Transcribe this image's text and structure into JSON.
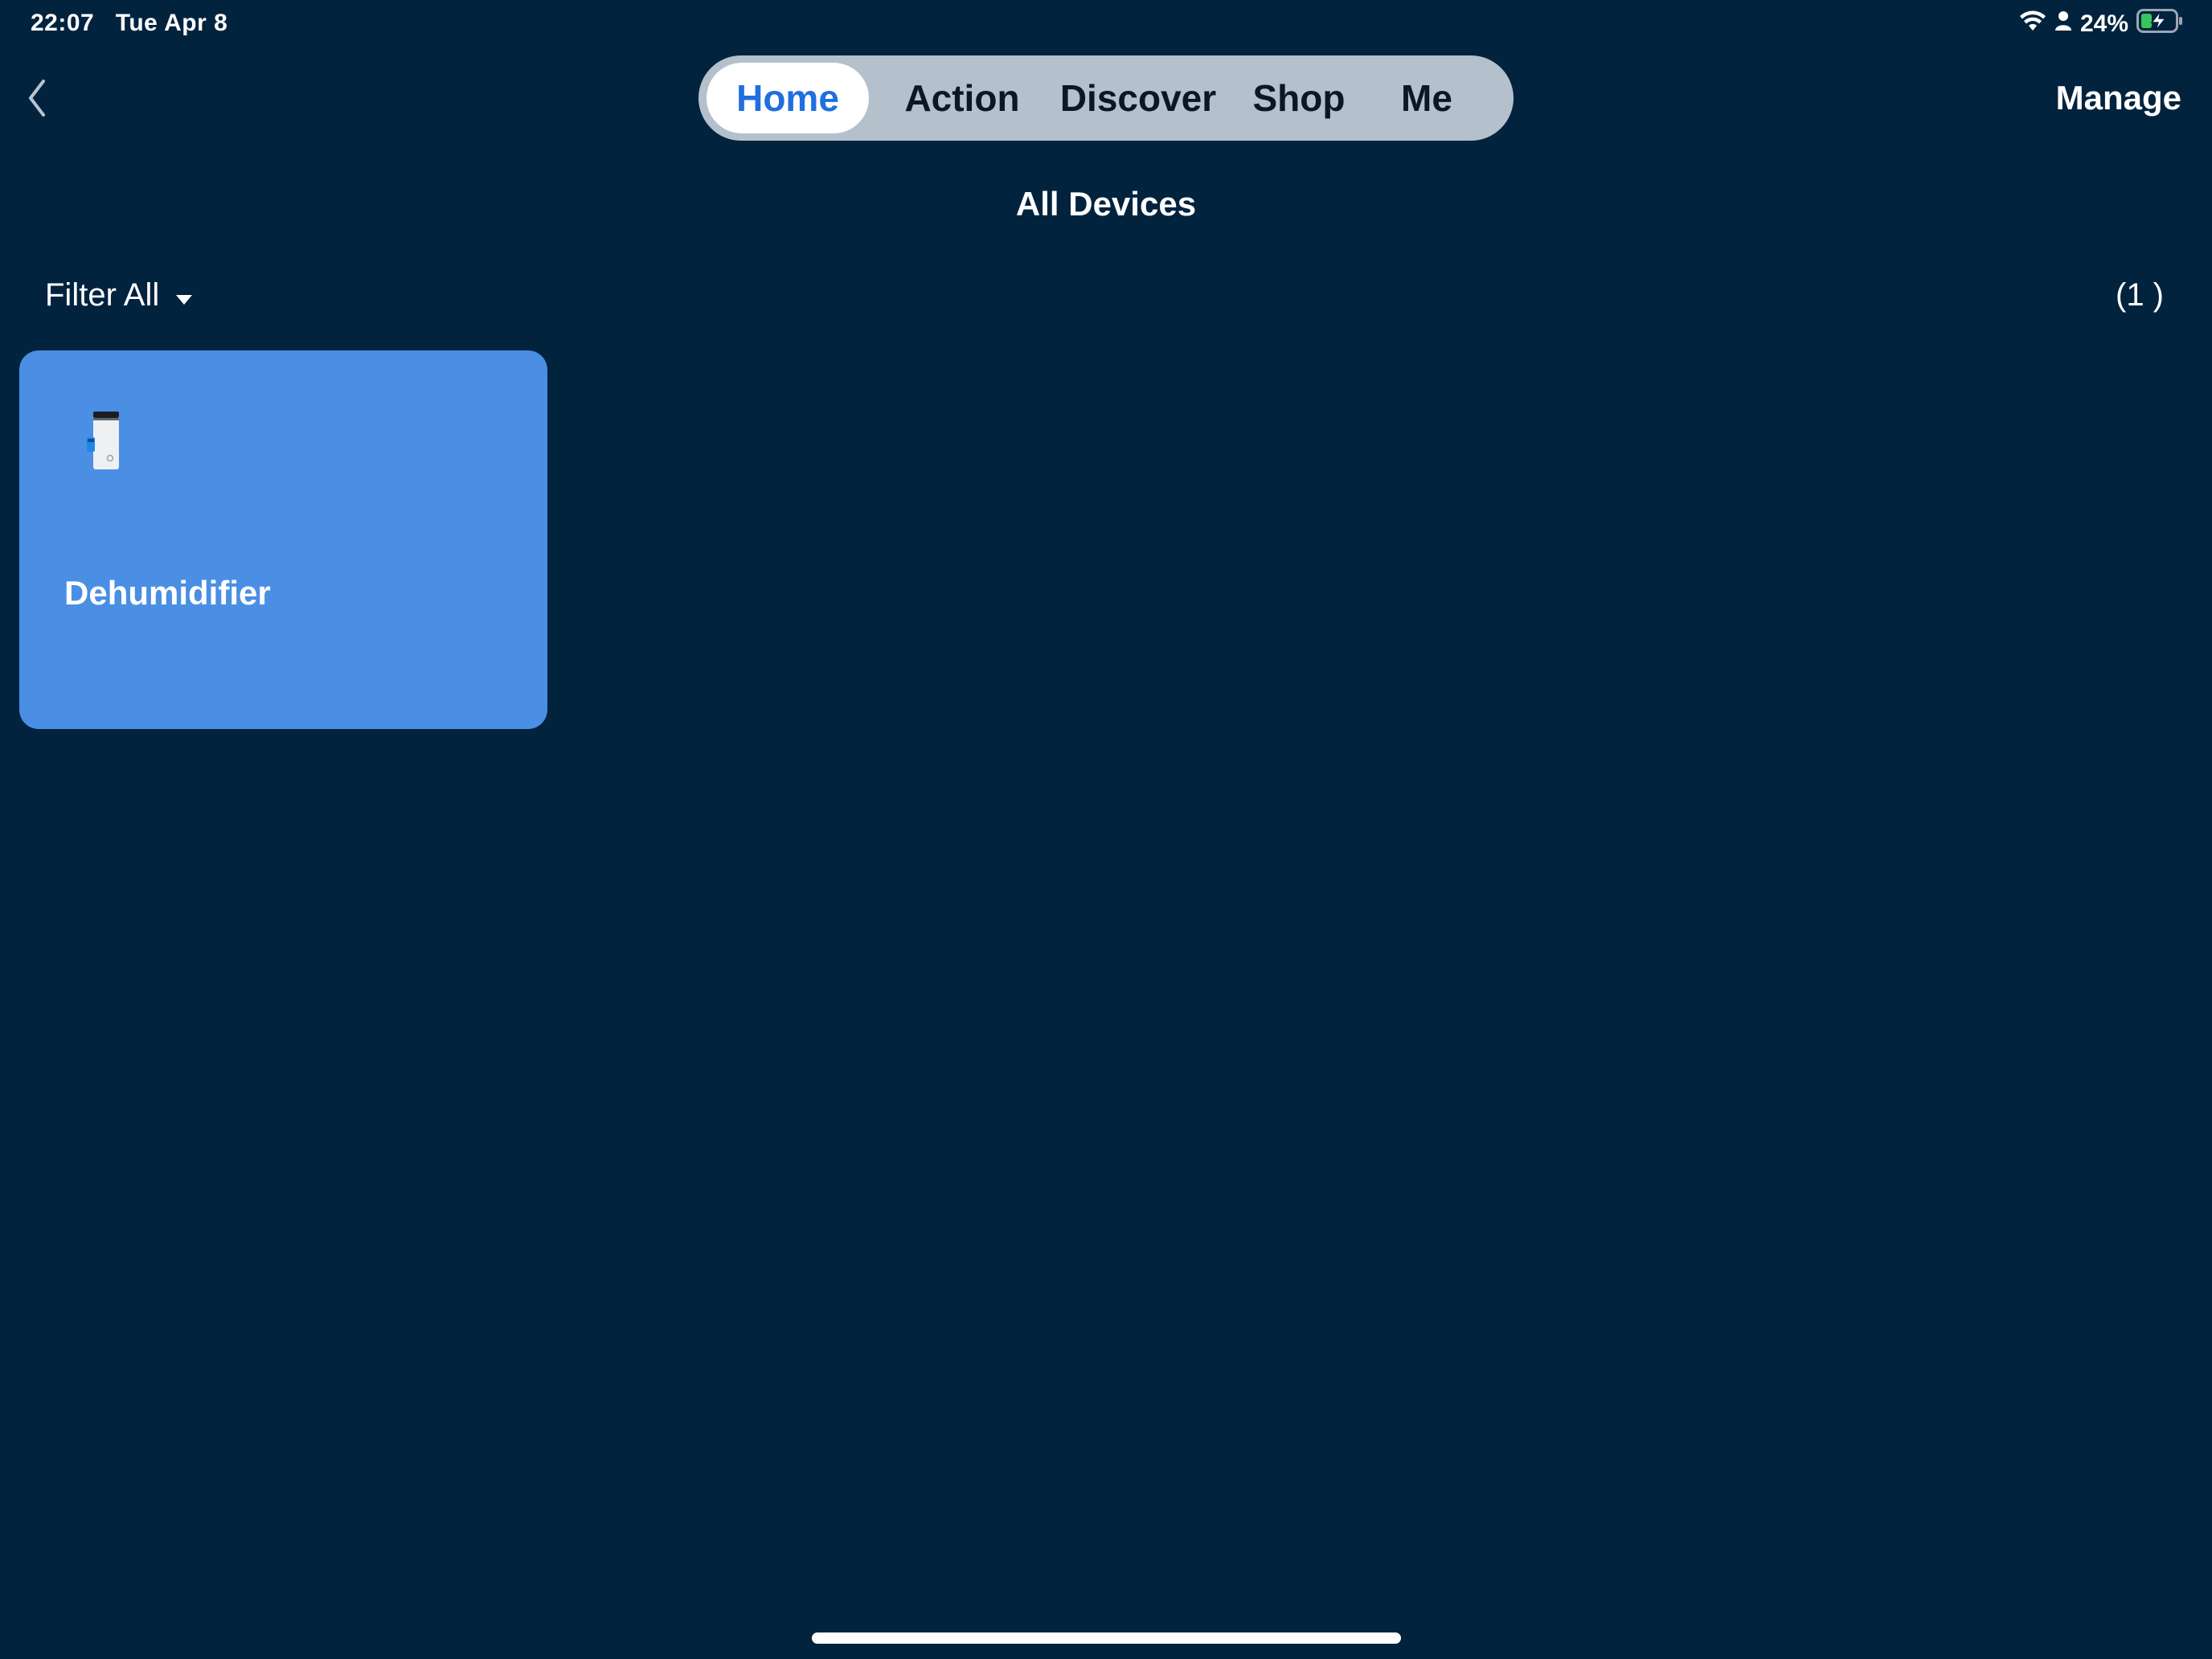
{
  "status_bar": {
    "time": "22:07",
    "date": "Tue Apr 8",
    "battery_percent": "24%",
    "icons": [
      "wifi-icon",
      "person-icon",
      "battery-charging-icon"
    ]
  },
  "nav": {
    "back_icon": "chevron-left-icon",
    "tabs": [
      {
        "label": "Home",
        "active": true
      },
      {
        "label": "Action",
        "active": false
      },
      {
        "label": "Discover",
        "active": false
      },
      {
        "label": "Shop",
        "active": false
      },
      {
        "label": "Me",
        "active": false
      }
    ],
    "manage_label": "Manage"
  },
  "page": {
    "title": "All Devices",
    "filter_label": "Filter All",
    "filter_icon": "caret-down-icon",
    "device_count": "(1 )"
  },
  "devices": [
    {
      "name": "Dehumidifier",
      "icon": "dehumidifier-icon"
    }
  ],
  "colors": {
    "background": "#02233e",
    "tab_bar": "#b4c0cc",
    "active_tab_text": "#1f6fe0",
    "card": "#4a8fe3"
  }
}
